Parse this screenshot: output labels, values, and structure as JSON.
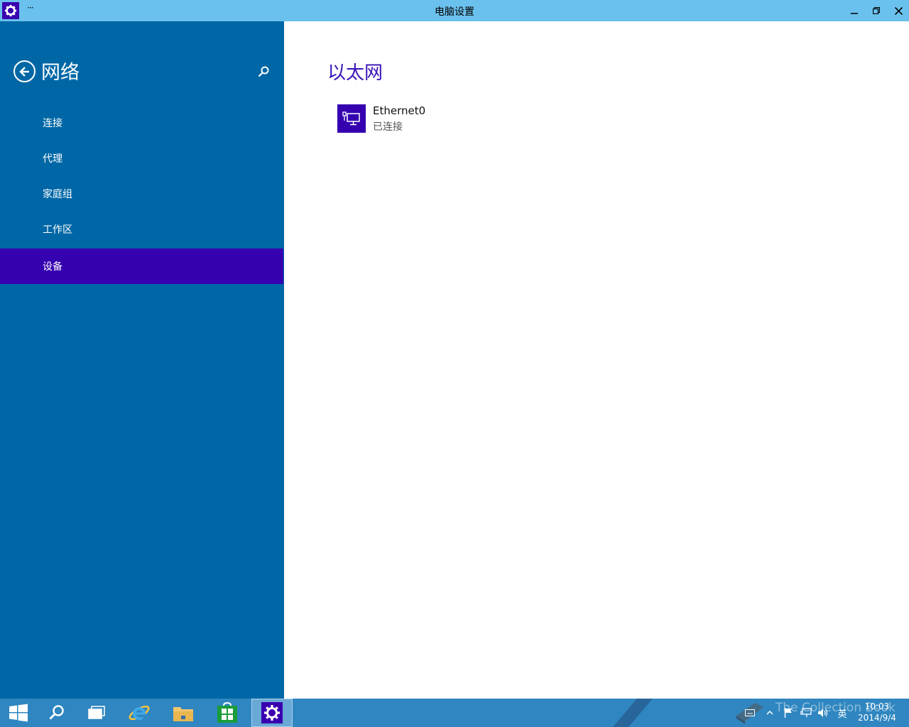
{
  "window": {
    "title": "电脑设置",
    "menu_glyph": "···"
  },
  "sidebar": {
    "title": "网络",
    "items": [
      {
        "label": "连接"
      },
      {
        "label": "代理"
      },
      {
        "label": "家庭组"
      },
      {
        "label": "工作区"
      },
      {
        "label": "设备",
        "selected": true
      }
    ]
  },
  "main": {
    "title": "以太网",
    "device": {
      "name": "Ethernet0",
      "status": "已连接",
      "icon": "ethernet-monitor-icon"
    }
  },
  "taskbar": {
    "apps": [
      "start-icon",
      "search-icon",
      "task-view-icon",
      "internet-explorer-icon",
      "file-explorer-icon",
      "store-icon",
      "settings-icon"
    ],
    "active_app": "settings-icon",
    "tray": {
      "language": "英",
      "time": "10:03",
      "date": "2014/9/4"
    },
    "watermark": "The Collection Book"
  },
  "colors": {
    "titlebar": "#6bc1ee",
    "sidebar": "#0067a6",
    "selected": "#3500b0",
    "accent_title": "#3a13b8",
    "taskbar": "#2f86c0"
  }
}
